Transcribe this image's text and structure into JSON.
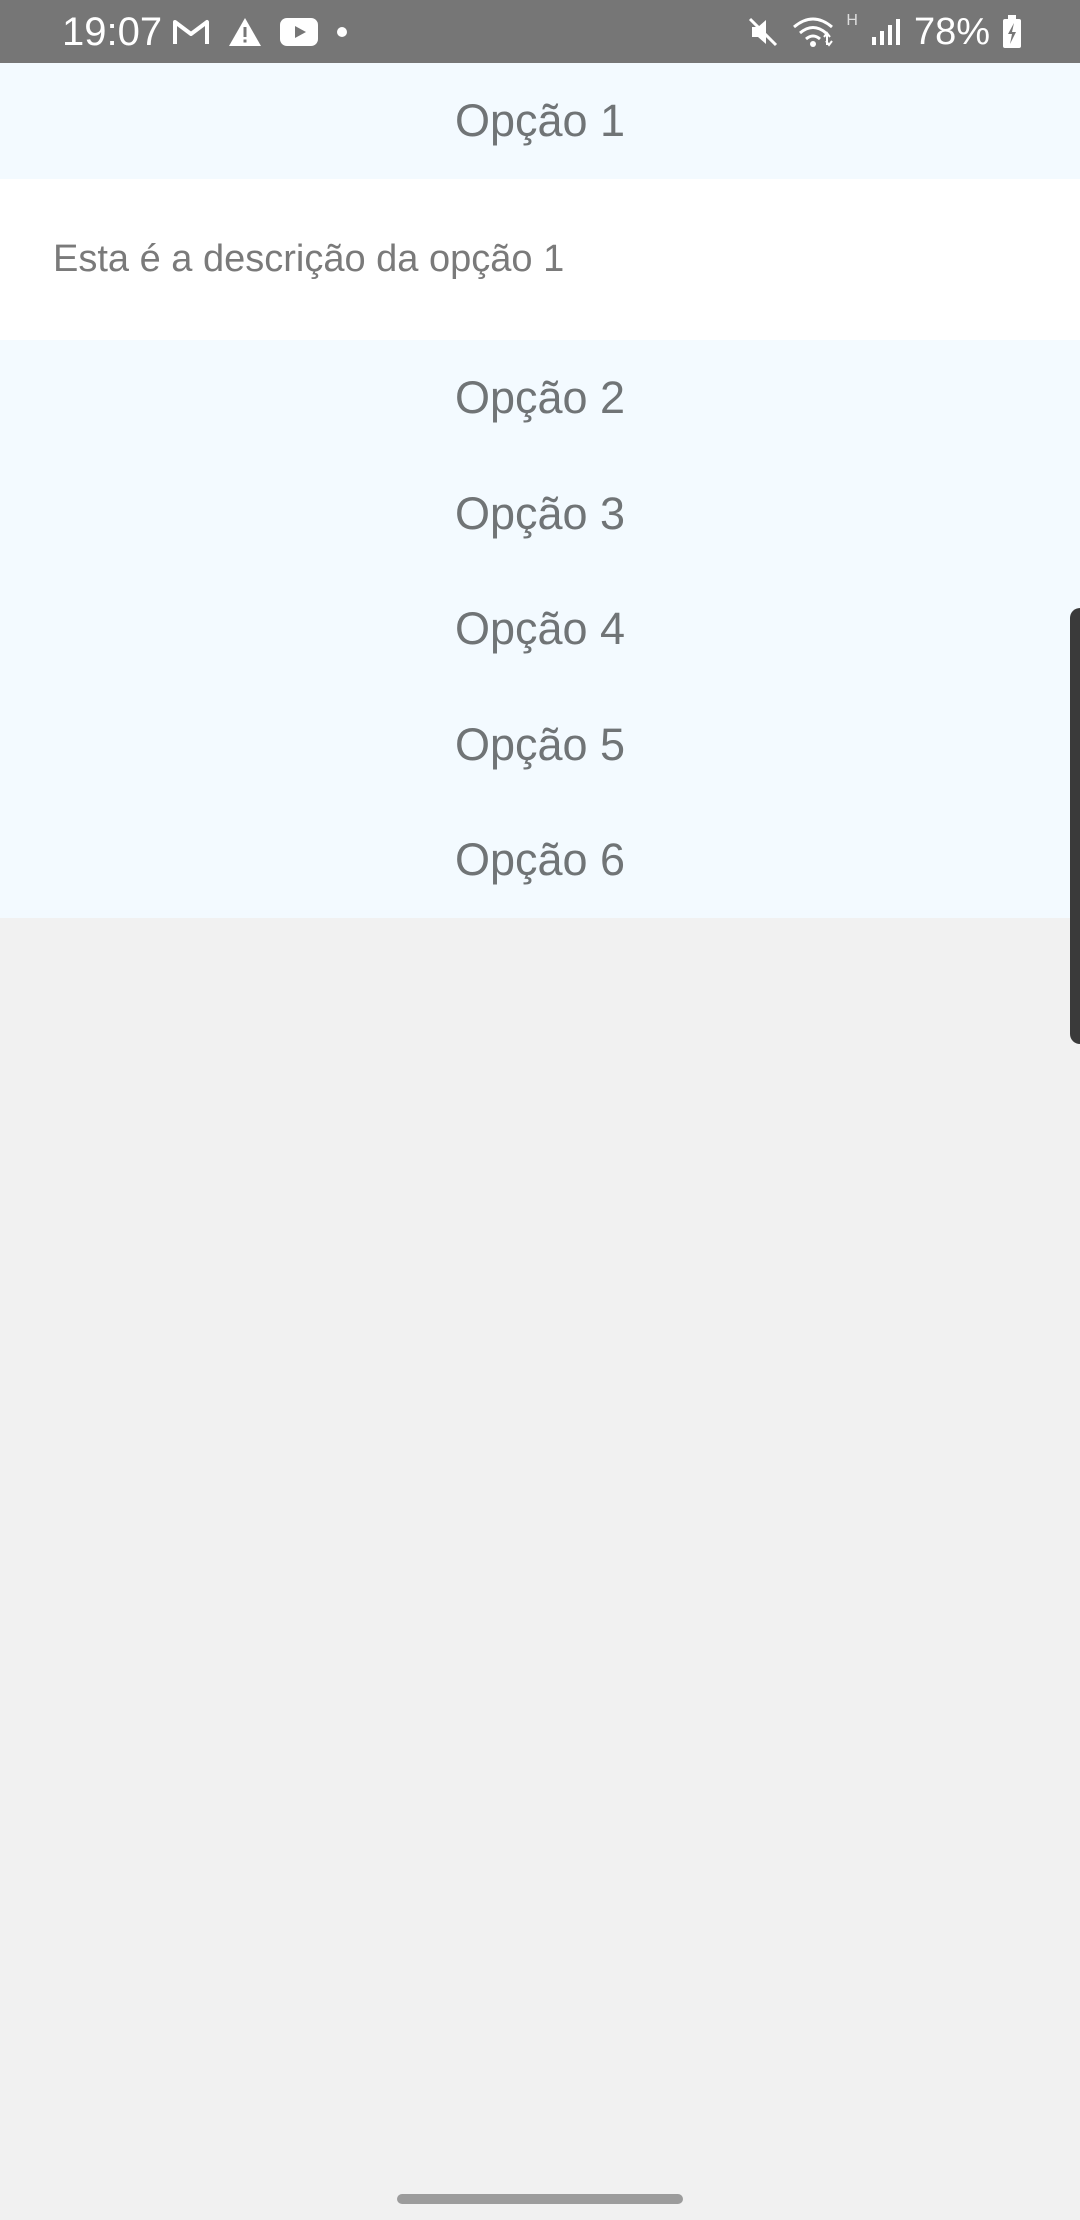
{
  "status_bar": {
    "time": "19:07",
    "battery_percent": "78%",
    "network_type": "H",
    "icons": [
      "gmail-icon",
      "warning-icon",
      "youtube-icon",
      "notification-dot-icon",
      "mute-icon",
      "wifi-icon",
      "signal-icon",
      "battery-charging-icon"
    ]
  },
  "accordion": {
    "expanded": {
      "title": "Opção 1",
      "description": "Esta é a descrição da opção 1"
    },
    "collapsed": [
      {
        "title": "Opção 2"
      },
      {
        "title": "Opção 3"
      },
      {
        "title": "Opção 4"
      },
      {
        "title": "Opção 5"
      },
      {
        "title": "Opção 6"
      }
    ]
  },
  "colors": {
    "status_bar_bg": "#767676",
    "header_bg": "#f3faff",
    "description_bg": "#ffffff",
    "page_bg": "#f1f1f1",
    "text": "#707476"
  }
}
